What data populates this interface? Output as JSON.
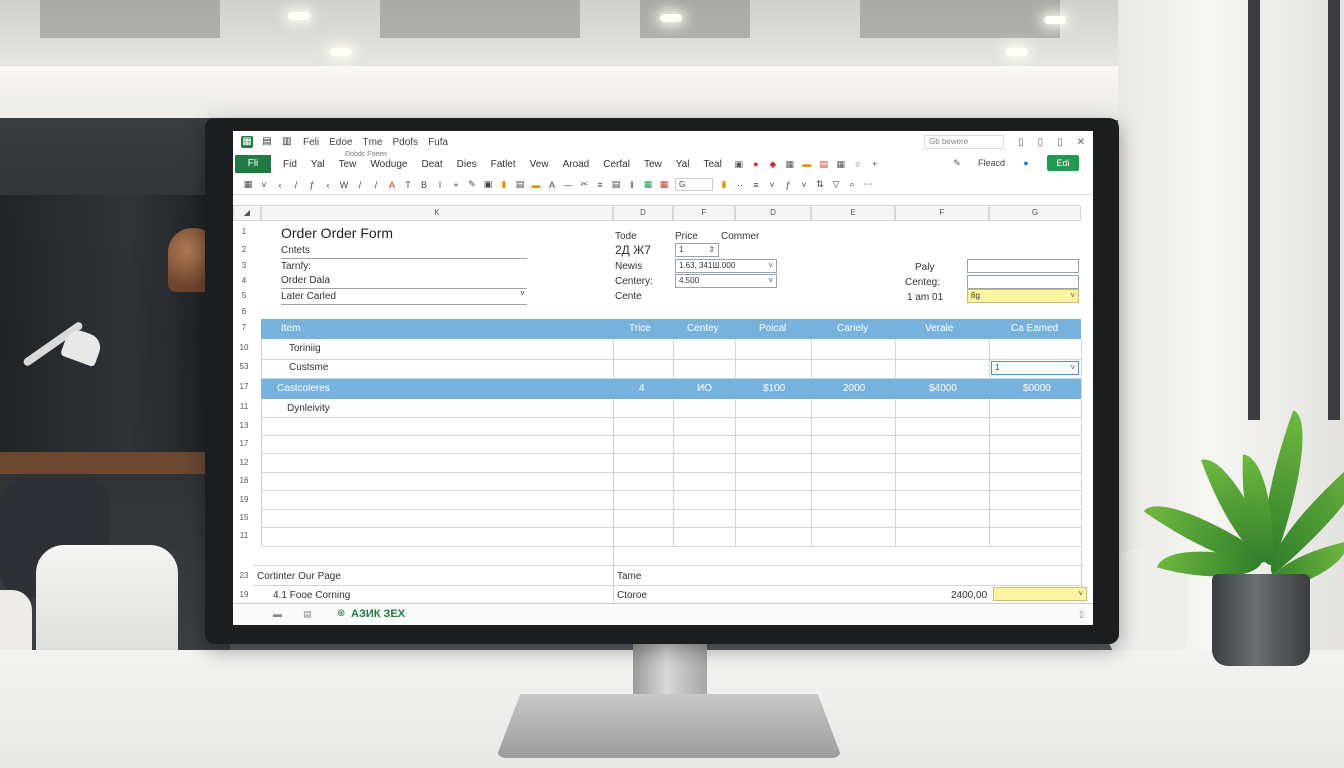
{
  "titlebar": {
    "menus": [
      "Feli",
      "Edoe",
      "Tme",
      "Pdofs",
      "Fufa"
    ],
    "search_text": "Gb bewere"
  },
  "menubar": {
    "file_tab": "Fli",
    "sub_name": "Dobdc Foeen",
    "menus": [
      "Fid",
      "Yal",
      "Tew",
      "Woduge",
      "Deat",
      "Dies",
      "Fatlet",
      "Vew",
      "Aroad",
      "Cerfal",
      "Tew",
      "Yal",
      "Teal"
    ],
    "right_label": "Fleacd",
    "action_button": "Edi"
  },
  "toolbar": {
    "zoom_box": "G"
  },
  "columns": [
    "K",
    "D",
    "F",
    "D",
    "E",
    "F",
    "G"
  ],
  "rows": [
    "1",
    "2",
    "3",
    "4",
    "5",
    "6",
    "7",
    "10",
    "53",
    "17",
    "11",
    "13",
    "17",
    "12",
    "16",
    "19",
    "15",
    "11",
    "23",
    "19",
    "23"
  ],
  "form": {
    "title": "Order Order Form",
    "label_1": "Cntets",
    "label_2": "Tarnfy:",
    "label_3": "Order Dala",
    "label_4": "Later Carled",
    "mid_label_1": "Tode",
    "mid_label_2": "Price",
    "mid_label_3": "Commer",
    "mid_value": "2Д Ж7",
    "mid_box_value": "1",
    "mid_label_4": "Newis",
    "mid_select_1": "1.63, 341Ш.000",
    "mid_label_5": "Centery:",
    "mid_select_2": "4.500",
    "mid_label_6": "Cente",
    "right_label_1": "Paly",
    "right_label_2": "Centeg:",
    "right_label_3": "1 am 01",
    "right_yellow_value": "6g"
  },
  "table": {
    "header": [
      "Item",
      "Trice",
      "Centey",
      "Poical",
      "Cariely",
      "Verale",
      "Ca Eamed"
    ],
    "rows": [
      {
        "item": "Toriniig"
      },
      {
        "item": "Custsme",
        "dropdown": "1"
      },
      {
        "item": "Castcoleres",
        "values": [
          "4",
          "ИО",
          "$100",
          "2000",
          "$4000",
          "$0000"
        ]
      },
      {
        "item": "Dynleivity"
      }
    ]
  },
  "footer": {
    "label_1": "Cortinter Our Page",
    "mid_label": "Tame",
    "label_2": "4.1 Fooe Corning",
    "mid_value": "Ctoroe",
    "total": "2400,00",
    "status_1": "АЗИК ЗЕХ"
  }
}
